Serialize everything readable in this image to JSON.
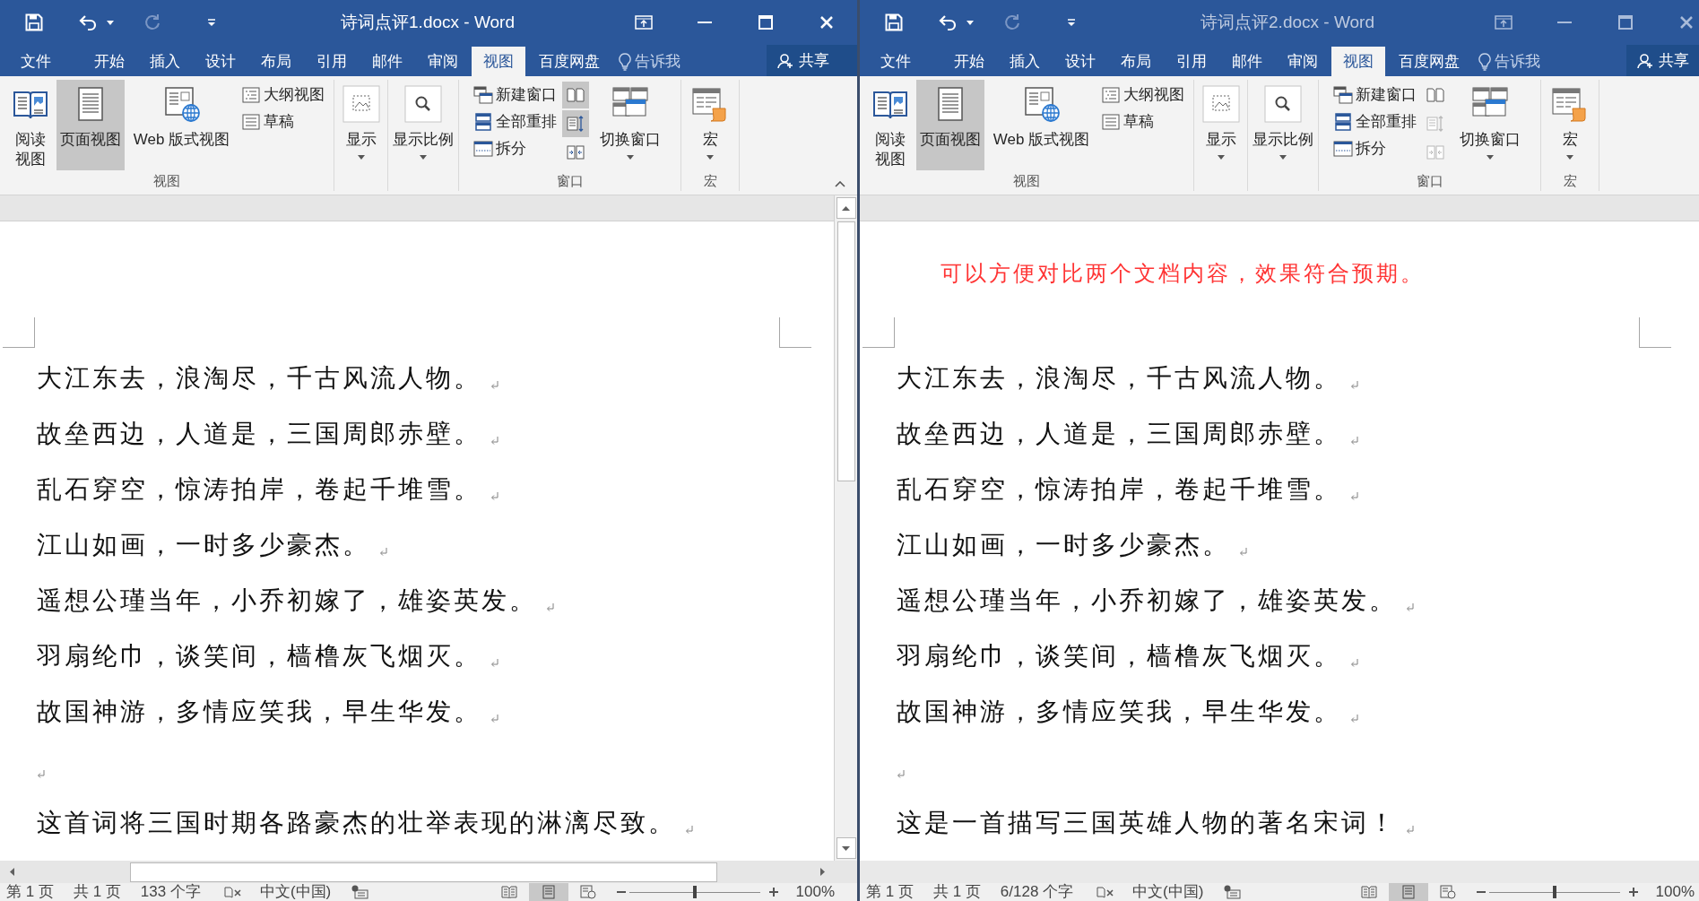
{
  "windows": [
    {
      "active": true,
      "title": "诗词点评1.docx - Word",
      "quick_access": [
        {
          "kind": "save",
          "disabled": false
        },
        {
          "kind": "undo",
          "disabled": false
        },
        {
          "kind": "redo",
          "disabled": true
        },
        {
          "kind": "customize",
          "disabled": false
        }
      ],
      "tabs": [
        {
          "label": "文件",
          "selected": false
        },
        {
          "label": "开始",
          "selected": false
        },
        {
          "label": "插入",
          "selected": false
        },
        {
          "label": "设计",
          "selected": false
        },
        {
          "label": "布局",
          "selected": false
        },
        {
          "label": "引用",
          "selected": false
        },
        {
          "label": "邮件",
          "selected": false
        },
        {
          "label": "审阅",
          "selected": false
        },
        {
          "label": "视图",
          "selected": true
        },
        {
          "label": "百度网盘",
          "selected": false
        }
      ],
      "tell_me": "告诉我",
      "share": "共享",
      "ribbon": [
        {
          "label": "视图",
          "buttons": [
            {
              "kind": "large",
              "label": "阅读视图",
              "selected": false
            },
            {
              "kind": "large",
              "label": "页面视图",
              "selected": true
            },
            {
              "kind": "large",
              "label": "Web 版式视图",
              "selected": false
            },
            {
              "kind": "small",
              "label": "大纲视图",
              "selected": false
            },
            {
              "kind": "small",
              "label": "草稿",
              "selected": false
            }
          ]
        },
        {
          "buttons": [
            {
              "kind": "large",
              "label": "显示",
              "caret": true
            }
          ]
        },
        {
          "buttons": [
            {
              "kind": "large",
              "label": "显示比例",
              "caret": true
            }
          ]
        },
        {
          "label": "窗口",
          "buttons": [
            {
              "kind": "small",
              "label": "新建窗口"
            },
            {
              "kind": "small",
              "label": "全部重排"
            },
            {
              "kind": "small",
              "label": "拆分"
            },
            {
              "kind": "icon",
              "selected": true,
              "disabled": false
            },
            {
              "kind": "icon",
              "selected": true,
              "disabled": false
            },
            {
              "kind": "icon",
              "selected": false,
              "disabled": false
            },
            {
              "kind": "large",
              "label": "切换窗口",
              "caret": true
            }
          ]
        },
        {
          "label": "宏",
          "buttons": [
            {
              "kind": "large",
              "label": "宏",
              "caret": true
            }
          ]
        }
      ],
      "collapse_ribbon": true,
      "document": {
        "paragraphs": [
          {
            "kind": "text",
            "text": "大江东去，浪淘尽，千古风流人物。"
          },
          {
            "kind": "text",
            "text": "故垒西边，人道是，三国周郎赤壁。"
          },
          {
            "kind": "text",
            "text": "乱石穿空，惊涛拍岸，卷起千堆雪。"
          },
          {
            "kind": "text",
            "text": "江山如画，一时多少豪杰。"
          },
          {
            "kind": "text",
            "text": "遥想公瑾当年，小乔初嫁了，雄姿英发。"
          },
          {
            "kind": "text",
            "text": "羽扇纶巾，谈笑间，樯橹灰飞烟灭。"
          },
          {
            "kind": "text",
            "text": "故国神游，多情应笑我，早生华发。"
          },
          {
            "kind": "blank"
          },
          {
            "kind": "text",
            "text": "这首词将三国时期各路豪杰的壮举表现的淋漓尽致。"
          }
        ]
      },
      "vertical_scrollbar": true,
      "horizontal_scrollbar": true,
      "status_bar": {
        "page": "第 1 页",
        "pages": "共 1 页",
        "words": "133 个字",
        "language": "中文(中国)",
        "views": [
          {
            "selected": false
          },
          {
            "selected": true
          },
          {
            "selected": false
          }
        ],
        "zoom_slider": {
          "level": 0.5
        },
        "zoom": "100%"
      }
    },
    {
      "active": false,
      "title": "诗词点评2.docx - Word",
      "quick_access": [
        {
          "kind": "save",
          "disabled": false
        },
        {
          "kind": "undo",
          "disabled": false
        },
        {
          "kind": "redo",
          "disabled": true
        },
        {
          "kind": "customize",
          "disabled": false
        }
      ],
      "tabs": [
        {
          "label": "文件",
          "selected": false
        },
        {
          "label": "开始",
          "selected": false
        },
        {
          "label": "插入",
          "selected": false
        },
        {
          "label": "设计",
          "selected": false
        },
        {
          "label": "布局",
          "selected": false
        },
        {
          "label": "引用",
          "selected": false
        },
        {
          "label": "邮件",
          "selected": false
        },
        {
          "label": "审阅",
          "selected": false
        },
        {
          "label": "视图",
          "selected": true
        },
        {
          "label": "百度网盘",
          "selected": false
        }
      ],
      "tell_me": "告诉我",
      "share": "共享",
      "ribbon": [
        {
          "label": "视图",
          "buttons": [
            {
              "kind": "large",
              "label": "阅读视图",
              "selected": false
            },
            {
              "kind": "large",
              "label": "页面视图",
              "selected": true
            },
            {
              "kind": "large",
              "label": "Web 版式视图",
              "selected": false
            },
            {
              "kind": "small",
              "label": "大纲视图",
              "selected": false
            },
            {
              "kind": "small",
              "label": "草稿",
              "selected": false
            }
          ]
        },
        {
          "buttons": [
            {
              "kind": "large",
              "label": "显示",
              "caret": true
            }
          ]
        },
        {
          "buttons": [
            {
              "kind": "large",
              "label": "显示比例",
              "caret": true
            }
          ]
        },
        {
          "label": "窗口",
          "buttons": [
            {
              "kind": "small",
              "label": "新建窗口"
            },
            {
              "kind": "small",
              "label": "全部重排"
            },
            {
              "kind": "small",
              "label": "拆分"
            },
            {
              "kind": "icon",
              "selected": false,
              "disabled": false
            },
            {
              "kind": "icon",
              "selected": false,
              "disabled": true
            },
            {
              "kind": "icon",
              "selected": false,
              "disabled": true
            },
            {
              "kind": "large",
              "label": "切换窗口",
              "caret": true
            }
          ]
        },
        {
          "label": "宏",
          "buttons": [
            {
              "kind": "large",
              "label": "宏",
              "caret": true
            }
          ]
        }
      ],
      "document": {
        "note": "可以方便对比两个文档内容，效果符合预期。",
        "paragraphs": [
          {
            "kind": "text",
            "text": "大江东去，浪淘尽，千古风流人物。"
          },
          {
            "kind": "text",
            "text": "故垒西边，人道是，三国周郎赤壁。"
          },
          {
            "kind": "text",
            "text": "乱石穿空，惊涛拍岸，卷起千堆雪。"
          },
          {
            "kind": "text",
            "text": "江山如画，一时多少豪杰。"
          },
          {
            "kind": "text",
            "text": "遥想公瑾当年，小乔初嫁了，雄姿英发。"
          },
          {
            "kind": "text",
            "text": "羽扇纶巾，谈笑间，樯橹灰飞烟灭。"
          },
          {
            "kind": "text",
            "text": "故国神游，多情应笑我，早生华发。"
          },
          {
            "kind": "blank"
          },
          {
            "kind": "text",
            "text": "这是一首描写三国英雄人物的著名宋词！"
          }
        ]
      },
      "horizontal_scrollbar": false,
      "status_bar": {
        "page": "第 1 页",
        "pages": "共 1 页",
        "words": "6/128 个字",
        "language": "中文(中国)",
        "views": [
          {
            "selected": false
          },
          {
            "selected": true
          },
          {
            "selected": false
          }
        ],
        "zoom_slider": {
          "level": 0.5
        },
        "zoom": "100%"
      }
    }
  ]
}
